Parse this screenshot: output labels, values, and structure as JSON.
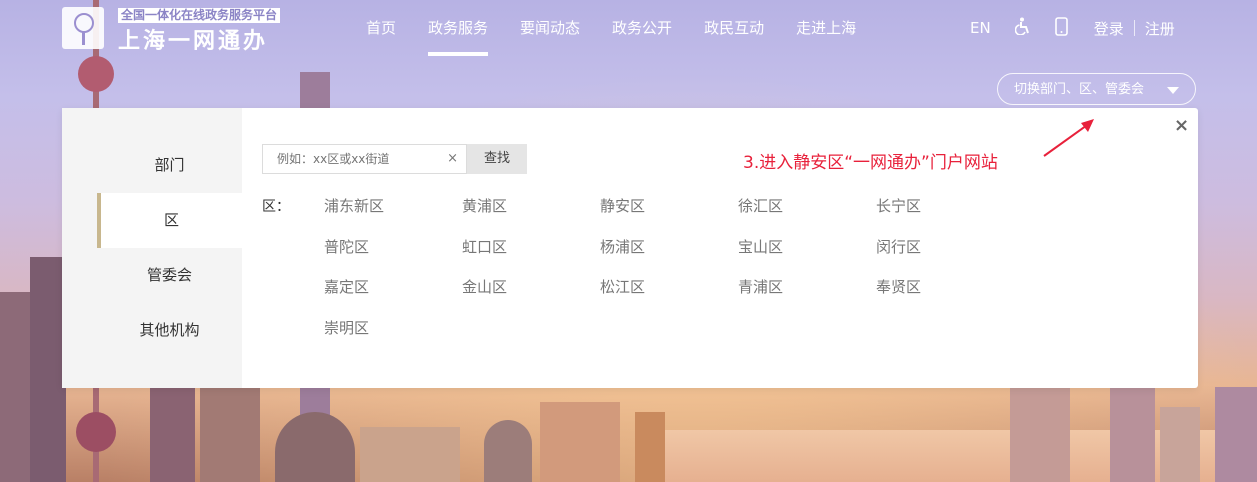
{
  "header": {
    "logo_tagline": "全国一体化在线政务服务平台",
    "logo_name": "上海一网通办",
    "nav": [
      {
        "label": "首页",
        "active": false
      },
      {
        "label": "政务服务",
        "active": true
      },
      {
        "label": "要闻动态",
        "active": false
      },
      {
        "label": "政务公开",
        "active": false
      },
      {
        "label": "政民互动",
        "active": false
      },
      {
        "label": "走进上海",
        "active": false
      }
    ],
    "lang_label": "EN",
    "login_label": "登录",
    "register_label": "注册"
  },
  "switcher": {
    "label": "切换部门、区、管委会"
  },
  "panel": {
    "side_items": [
      {
        "label": "部门",
        "active": false
      },
      {
        "label": "区",
        "active": true
      },
      {
        "label": "管委会",
        "active": false
      },
      {
        "label": "其他机构",
        "active": false
      }
    ],
    "search": {
      "placeholder": "例如：xx区或xx街道",
      "clear": "×",
      "button": "查找"
    },
    "close": "×",
    "district_label": "区：",
    "districts": [
      "浦东新区",
      "黄浦区",
      "静安区",
      "徐汇区",
      "长宁区",
      "普陀区",
      "虹口区",
      "杨浦区",
      "宝山区",
      "闵行区",
      "嘉定区",
      "金山区",
      "松江区",
      "青浦区",
      "奉贤区",
      "崇明区"
    ]
  },
  "annotation": {
    "text": "3.进入静安区“一网通办”门户网站",
    "color": "#e8213b"
  },
  "colors": {
    "accent_gold": "#c8b78e",
    "nav_text": "#ffffff"
  }
}
